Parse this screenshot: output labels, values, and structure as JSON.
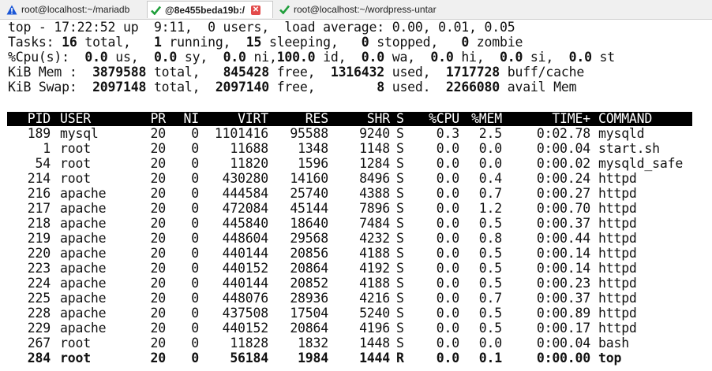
{
  "tabs": [
    {
      "title": "root@localhost:~/mariadb",
      "icon": "warning-icon"
    },
    {
      "title": "@8e455beda19b:/",
      "icon": "check-icon",
      "active": true
    },
    {
      "title": "root@localhost:~/wordpress-untar",
      "icon": "check-icon"
    }
  ],
  "colors": {
    "warning": "#1a56d6",
    "check": "#1e9e3a",
    "close": "#e34b4b"
  },
  "summary": [
    "top - 17:22:52 up  9:11,  0 users,  load average: 0.00, 0.01, 0.05",
    "Tasks: 16 total,   1 running,  15 sleeping,   0 stopped,   0 zombie",
    "%Cpu(s):  0.0 us,  0.0 sy,  0.0 ni,100.0 id,  0.0 wa,  0.0 hi,  0.0 si,  0.0 st",
    "KiB Mem :  3879588 total,   845428 free,  1316432 used,  1717728 buff/cache",
    "KiB Swap:  2097148 total,  2097140 free,        8 used.  2266080 avail Mem"
  ],
  "columns": [
    "PID",
    "USER",
    "PR",
    "NI",
    "VIRT",
    "RES",
    "SHR",
    "S",
    "%CPU",
    "%MEM",
    "TIME+",
    "COMMAND"
  ],
  "processes": [
    [
      "189",
      "mysql",
      "20",
      "0",
      "1101416",
      "95588",
      "9240",
      "S",
      "0.3",
      "2.5",
      "0:02.78",
      "mysqld"
    ],
    [
      "1",
      "root",
      "20",
      "0",
      "11688",
      "1348",
      "1148",
      "S",
      "0.0",
      "0.0",
      "0:00.04",
      "start.sh"
    ],
    [
      "54",
      "root",
      "20",
      "0",
      "11820",
      "1596",
      "1284",
      "S",
      "0.0",
      "0.0",
      "0:00.02",
      "mysqld_safe"
    ],
    [
      "214",
      "root",
      "20",
      "0",
      "430280",
      "14160",
      "8496",
      "S",
      "0.0",
      "0.4",
      "0:00.24",
      "httpd"
    ],
    [
      "216",
      "apache",
      "20",
      "0",
      "444584",
      "25740",
      "4388",
      "S",
      "0.0",
      "0.7",
      "0:00.27",
      "httpd"
    ],
    [
      "217",
      "apache",
      "20",
      "0",
      "472084",
      "45144",
      "7896",
      "S",
      "0.0",
      "1.2",
      "0:00.70",
      "httpd"
    ],
    [
      "218",
      "apache",
      "20",
      "0",
      "445840",
      "18640",
      "7484",
      "S",
      "0.0",
      "0.5",
      "0:00.37",
      "httpd"
    ],
    [
      "219",
      "apache",
      "20",
      "0",
      "448604",
      "29568",
      "4232",
      "S",
      "0.0",
      "0.8",
      "0:00.44",
      "httpd"
    ],
    [
      "220",
      "apache",
      "20",
      "0",
      "440144",
      "20856",
      "4188",
      "S",
      "0.0",
      "0.5",
      "0:00.14",
      "httpd"
    ],
    [
      "223",
      "apache",
      "20",
      "0",
      "440152",
      "20864",
      "4192",
      "S",
      "0.0",
      "0.5",
      "0:00.14",
      "httpd"
    ],
    [
      "224",
      "apache",
      "20",
      "0",
      "440144",
      "20852",
      "4188",
      "S",
      "0.0",
      "0.5",
      "0:00.23",
      "httpd"
    ],
    [
      "225",
      "apache",
      "20",
      "0",
      "448076",
      "28936",
      "4216",
      "S",
      "0.0",
      "0.7",
      "0:00.37",
      "httpd"
    ],
    [
      "228",
      "apache",
      "20",
      "0",
      "437508",
      "17504",
      "5240",
      "S",
      "0.0",
      "0.5",
      "0:00.89",
      "httpd"
    ],
    [
      "229",
      "apache",
      "20",
      "0",
      "440152",
      "20864",
      "4196",
      "S",
      "0.0",
      "0.5",
      "0:00.17",
      "httpd"
    ],
    [
      "267",
      "root",
      "20",
      "0",
      "11828",
      "1832",
      "1448",
      "S",
      "0.0",
      "0.0",
      "0:00.04",
      "bash"
    ],
    [
      "284",
      "root",
      "20",
      "0",
      "56184",
      "1984",
      "1444",
      "R",
      "0.0",
      "0.1",
      "0:00.00",
      "top"
    ]
  ],
  "bold_row_pid": "284"
}
